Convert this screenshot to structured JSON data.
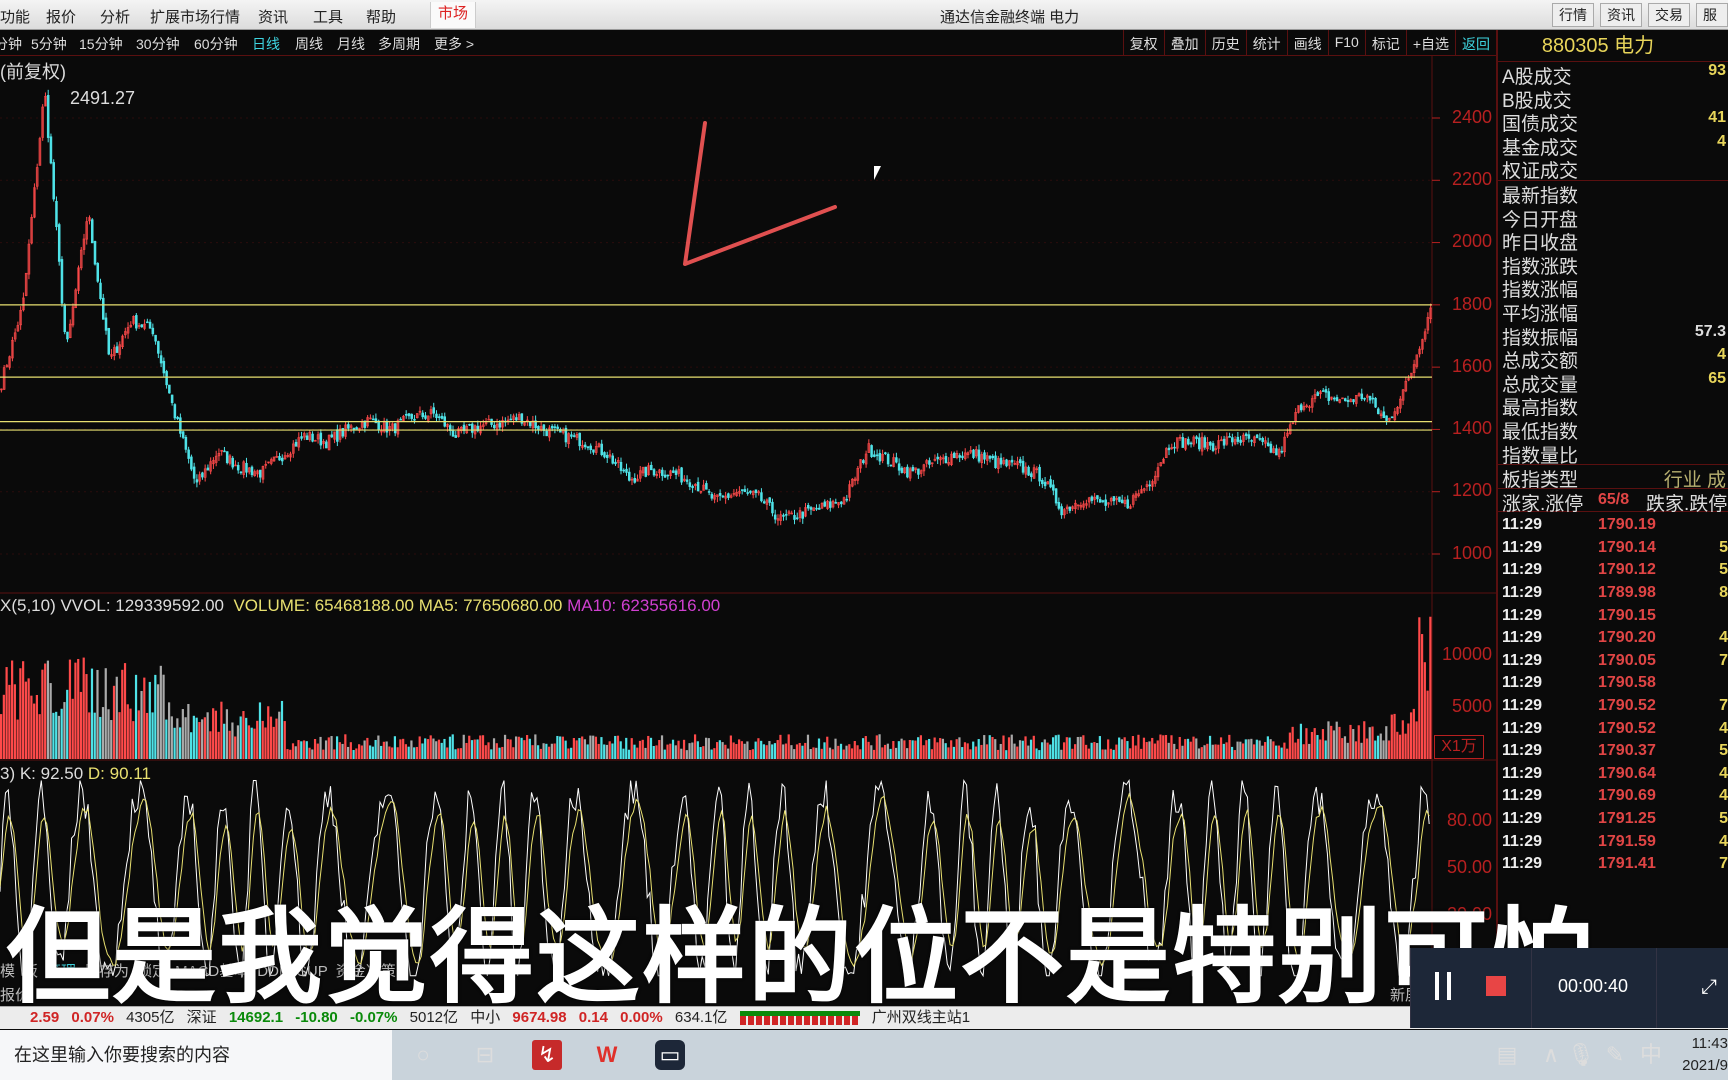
{
  "menu": {
    "items": [
      "功能",
      "报价",
      "分析",
      "扩展市场行情",
      "资讯",
      "工具",
      "帮助"
    ],
    "active": "市场",
    "title": "通达信金融终端 电力",
    "right_buttons": [
      "行情",
      "资讯",
      "交易",
      "服务"
    ]
  },
  "period_bar": {
    "items": [
      "分钟",
      "5分钟",
      "15分钟",
      "30分钟",
      "60分钟",
      "日线",
      "周线",
      "月线",
      "多周期",
      "更多 >"
    ],
    "selected": "日线",
    "tools": [
      "复权",
      "叠加",
      "历史",
      "统计",
      "画线",
      "F10",
      "标记",
      "+自选",
      "返回"
    ]
  },
  "chart_header": {
    "adjust": "(前复权)",
    "peak_label": "2491.27"
  },
  "chart_data": {
    "type": "candlestick",
    "y_ticks": [
      2400,
      2200,
      2000,
      1800,
      1600,
      1400,
      1200,
      1000
    ],
    "ylim": [
      900,
      2560
    ],
    "peak": 2491.27,
    "close_path": [
      1550,
      1800,
      2491,
      1650,
      2100,
      1620,
      1750,
      1720,
      1450,
      1220,
      1330,
      1280,
      1260,
      1320,
      1380,
      1360,
      1400,
      1430,
      1400,
      1440,
      1450,
      1380,
      1410,
      1420,
      1440,
      1400,
      1380,
      1360,
      1320,
      1240,
      1270,
      1260,
      1230,
      1170,
      1200,
      1180,
      1110,
      1130,
      1150,
      1180,
      1340,
      1300,
      1260,
      1290,
      1320,
      1320,
      1290,
      1280,
      1250,
      1140,
      1180,
      1160,
      1160,
      1230,
      1360,
      1360,
      1350,
      1370,
      1360,
      1320,
      1480,
      1510,
      1490,
      1510,
      1420,
      1560,
      1790
    ],
    "horizontal_lines": [
      1800,
      1568,
      1425,
      1398
    ],
    "colors": {
      "up": "#ff4a4a",
      "down": "#4fe3e8",
      "hline": "#e8e070",
      "axis": "#b82020",
      "drawing": "#e05050"
    },
    "volume": {
      "label": "X(5,10) VVOL: 129339592.00",
      "volume": "VOLUME: 65468188.00",
      "ma5": "MA5: 77650680.00",
      "ma10": "MA10: 62355616.00",
      "y_ticks": [
        10000,
        5000
      ],
      "unit": "X1万",
      "ylim": [
        0,
        13000
      ]
    },
    "kdj": {
      "label": "3) K: 92.50",
      "d": "D: 90.11",
      "y_ticks": [
        "80.00",
        "50.00",
        "20.00"
      ],
      "ylim": [
        0,
        110
      ]
    }
  },
  "right_panel": {
    "title": "880305 电力",
    "stats1": [
      {
        "label": "A股成交",
        "value": "93"
      },
      {
        "label": "B股成交",
        "value": ""
      },
      {
        "label": "国债成交",
        "value": "41"
      },
      {
        "label": "基金成交",
        "value": "4"
      },
      {
        "label": "权证成交",
        "value": ""
      }
    ],
    "stats2": [
      {
        "label": "最新指数",
        "value": ""
      },
      {
        "label": "今日开盘",
        "value": ""
      },
      {
        "label": "昨日收盘",
        "value": ""
      },
      {
        "label": "指数涨跌",
        "value": ""
      },
      {
        "label": "指数涨幅",
        "value": ""
      },
      {
        "label": "平均涨幅",
        "value": ""
      },
      {
        "label": "指数振幅",
        "value": "57.3"
      },
      {
        "label": "总成交额",
        "value": "4"
      },
      {
        "label": "总成交量",
        "value": "65"
      },
      {
        "label": "最高指数",
        "value": ""
      },
      {
        "label": "最低指数",
        "value": ""
      },
      {
        "label": "指数量比",
        "value": ""
      }
    ],
    "type_row": {
      "label": "板指类型",
      "value": "行业 成"
    },
    "updown_row": {
      "label": "涨家.涨停",
      "value": "65/8",
      "label2": "跌家.跌停"
    },
    "ticks": [
      {
        "t": "11:29",
        "p": "1790.19",
        "q": ""
      },
      {
        "t": "11:29",
        "p": "1790.14",
        "q": "5"
      },
      {
        "t": "11:29",
        "p": "1790.12",
        "q": "5"
      },
      {
        "t": "11:29",
        "p": "1789.98",
        "q": "8"
      },
      {
        "t": "11:29",
        "p": "1790.15",
        "q": ""
      },
      {
        "t": "11:29",
        "p": "1790.20",
        "q": "4"
      },
      {
        "t": "11:29",
        "p": "1790.05",
        "q": "7"
      },
      {
        "t": "11:29",
        "p": "1790.58",
        "q": ""
      },
      {
        "t": "11:29",
        "p": "1790.52",
        "q": "7"
      },
      {
        "t": "11:29",
        "p": "1790.52",
        "q": "4"
      },
      {
        "t": "11:29",
        "p": "1790.37",
        "q": "5"
      },
      {
        "t": "11:29",
        "p": "1790.64",
        "q": "4"
      },
      {
        "t": "11:29",
        "p": "1790.69",
        "q": "4"
      },
      {
        "t": "11:29",
        "p": "1791.25",
        "q": "5"
      },
      {
        "t": "11:29",
        "p": "1791.59",
        "q": "4"
      },
      {
        "t": "11:29",
        "p": "1791.41",
        "q": "7"
      }
    ]
  },
  "bottom_tabs": {
    "items": [
      "模",
      "板",
      "管理",
      "另存为",
      "锁定",
      "MACD基本",
      "DDE",
      "SUP",
      "资金决策"
    ],
    "selected": "管理",
    "quote": "报价",
    "newest": "新屏"
  },
  "status_bar": {
    "sh": [
      "2.59",
      "0.07%",
      "4305亿"
    ],
    "sz_label": "深证",
    "sz": [
      "14692.1",
      "-10.80",
      "-0.07%",
      "5012亿"
    ],
    "zx_label": "中小",
    "zx": [
      "9674.98",
      "0.14",
      "0.00%",
      "634.1亿"
    ],
    "server": "广州双线主站1"
  },
  "recorder": {
    "time": "00:00:40"
  },
  "subtitle": "但是我觉得这样的位不是特别可怕",
  "taskbar": {
    "search_placeholder": "在这里输入你要搜索的内容",
    "ime": "中",
    "time": "11:43",
    "date": "2021/9"
  }
}
